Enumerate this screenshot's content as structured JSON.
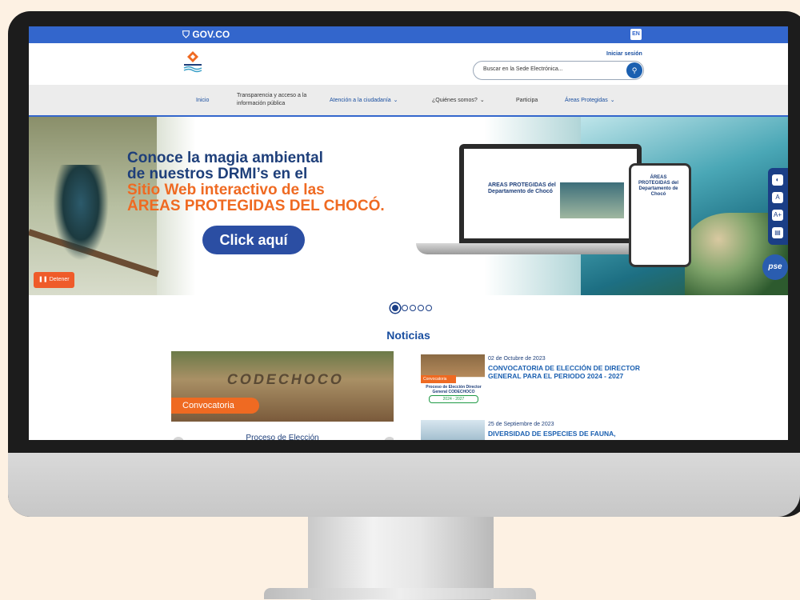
{
  "gov_bar": {
    "logo_text": "GOV.CO",
    "lang_label": "EN"
  },
  "header": {
    "login": "Iniciar sesión",
    "search_placeholder": "Buscar en la Sede Electrónica...",
    "logo_text": "CODECHOCO"
  },
  "nav": {
    "items": [
      {
        "label": "Inicio",
        "has_menu": false
      },
      {
        "label": "Transparencia y acceso a la información pública",
        "has_menu": false
      },
      {
        "label": "Atención a la ciudadanía",
        "has_menu": true
      },
      {
        "label": "¿Quiénes somos?",
        "has_menu": true
      },
      {
        "label": "Participa",
        "has_menu": false
      },
      {
        "label": "Áreas Protegidas",
        "has_menu": true
      }
    ]
  },
  "hero": {
    "line1": "Conoce la magia ambiental",
    "line2": "de nuestros DRMI’s en el",
    "line3": "Sitio Web interactivo de las",
    "line4": "ÁREAS PROTEGIDAS DEL CHOCÓ.",
    "cta": "Click aquí",
    "stop": "Detener",
    "laptop_title": "AREAS PROTEGIDAS del Departamento de Chocó",
    "phone_title": "ÁREAS PROTEGIDAS del Departamento de Chocó"
  },
  "carousel": {
    "total": 5,
    "active": 1
  },
  "side_tools": [
    "◐",
    "A",
    "A+",
    "▤"
  ],
  "pse": "pse",
  "news": {
    "title": "Noticias",
    "featured": {
      "tag": "Convocatoria",
      "sign": "CODECHOCO",
      "caption": "Proceso de Elección"
    },
    "items": [
      {
        "date": "02 de Octubre de 2023",
        "headline": "CONVOCATORIA DE ELECCIÓN DE DIRECTOR GENERAL PARA EL PERIODO 2024 - 2027",
        "thumb_tag": "Convocatoria",
        "thumb_text": "Proceso de Elección Director General CODECHOCO",
        "thumb_badge": "2024 - 2027"
      },
      {
        "date": "25 de Septiembre de 2023",
        "headline": "DIVERSIDAD DE ESPECIES DE FAUNA,"
      }
    ]
  },
  "colors": {
    "gov_blue": "#3366cc",
    "navy": "#1e3f7a",
    "orange": "#ef6a22",
    "link_blue": "#1a4fa0"
  }
}
